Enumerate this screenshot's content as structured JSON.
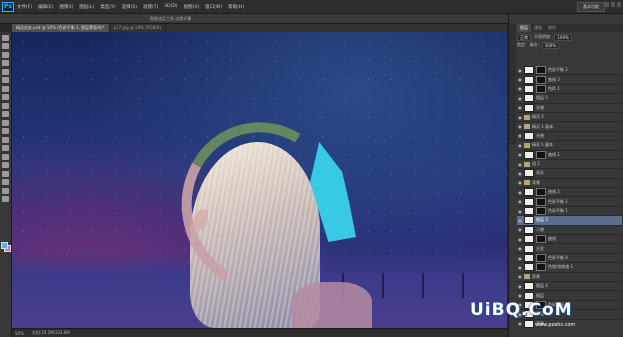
{
  "app": {
    "logo": "Ps"
  },
  "menu": [
    "文件(F)",
    "编辑(E)",
    "图像(I)",
    "图层(L)",
    "类型(Y)",
    "选择(S)",
    "滤镜(T)",
    "3D(D)",
    "视图(V)",
    "窗口(W)",
    "帮助(H)"
  ],
  "workspace": "基本功能",
  "options": {
    "hint": "智能选区工具  边缘光晕"
  },
  "tabs": [
    {
      "label": "精灵仙女.psd @ 50% (色彩平衡 1, 图层蒙版/8)*"
    },
    {
      "label": "p17.jpg @ 50% (RGB/8)"
    }
  ],
  "status": {
    "zoom": "50%",
    "doc": "文档:10.1M/331.6M"
  },
  "panels": {
    "tabs": [
      "图层",
      "通道",
      "路径"
    ],
    "blend_mode": "正常",
    "opacity_label": "不透明度:",
    "opacity": "100%",
    "fill_label": "填充:",
    "fill": "100%",
    "lock_label": "锁定:"
  },
  "layers": [
    {
      "name": "色彩平衡 2",
      "kind": "adj",
      "eye": "●"
    },
    {
      "name": "曲线 3",
      "kind": "adj",
      "eye": "●"
    },
    {
      "name": "色阶 1",
      "kind": "adj",
      "eye": "●"
    },
    {
      "name": "图层 5",
      "kind": "pixel",
      "eye": "●"
    },
    {
      "name": "光感",
      "kind": "pixel",
      "eye": "●"
    },
    {
      "name": "精灵 2",
      "kind": "group",
      "eye": "●"
    },
    {
      "name": "精灵 1 副本",
      "kind": "group",
      "eye": "●"
    },
    {
      "name": "光感",
      "kind": "pixel",
      "eye": "●"
    },
    {
      "name": "精灵 1 副本",
      "kind": "group",
      "eye": "●"
    },
    {
      "name": "曲线 1",
      "kind": "adj",
      "eye": "●"
    },
    {
      "name": "组 2",
      "kind": "group",
      "eye": "●"
    },
    {
      "name": "耳朵",
      "kind": "pixel",
      "eye": "●"
    },
    {
      "name": "背景",
      "kind": "group",
      "eye": "●"
    },
    {
      "name": "曲线 2",
      "kind": "adj",
      "eye": "●"
    },
    {
      "name": "色彩平衡 1",
      "kind": "adj",
      "eye": "●"
    },
    {
      "name": "色彩平衡 1",
      "kind": "adj",
      "eye": "●"
    },
    {
      "name": "图层 3",
      "kind": "pixel",
      "eye": "●",
      "selected": true
    },
    {
      "name": "人物",
      "kind": "pixel",
      "eye": "●"
    },
    {
      "name": "曲线",
      "kind": "adj",
      "eye": "●"
    },
    {
      "name": "头发",
      "kind": "pixel",
      "eye": "●"
    },
    {
      "name": "色彩平衡 4",
      "kind": "adj",
      "eye": "●"
    },
    {
      "name": "色相/饱和度 1",
      "kind": "adj",
      "eye": "●"
    },
    {
      "name": "背景",
      "kind": "group",
      "eye": "●"
    },
    {
      "name": "图层 4",
      "kind": "pixel",
      "eye": "●"
    },
    {
      "name": "图层",
      "kind": "pixel",
      "eye": "●"
    },
    {
      "name": "色彩平衡 1",
      "kind": "adj",
      "eye": "●"
    },
    {
      "name": "图层 2",
      "kind": "pixel",
      "eye": "●"
    },
    {
      "name": "背景",
      "kind": "pixel",
      "eye": "●"
    }
  ],
  "watermark": {
    "brand": "UiBQ.CoM",
    "url": "www.psahz.com"
  },
  "colors": {
    "foreground": "#4ab9e6",
    "background": "#d66ed6",
    "selection": "#5a6f8f"
  }
}
